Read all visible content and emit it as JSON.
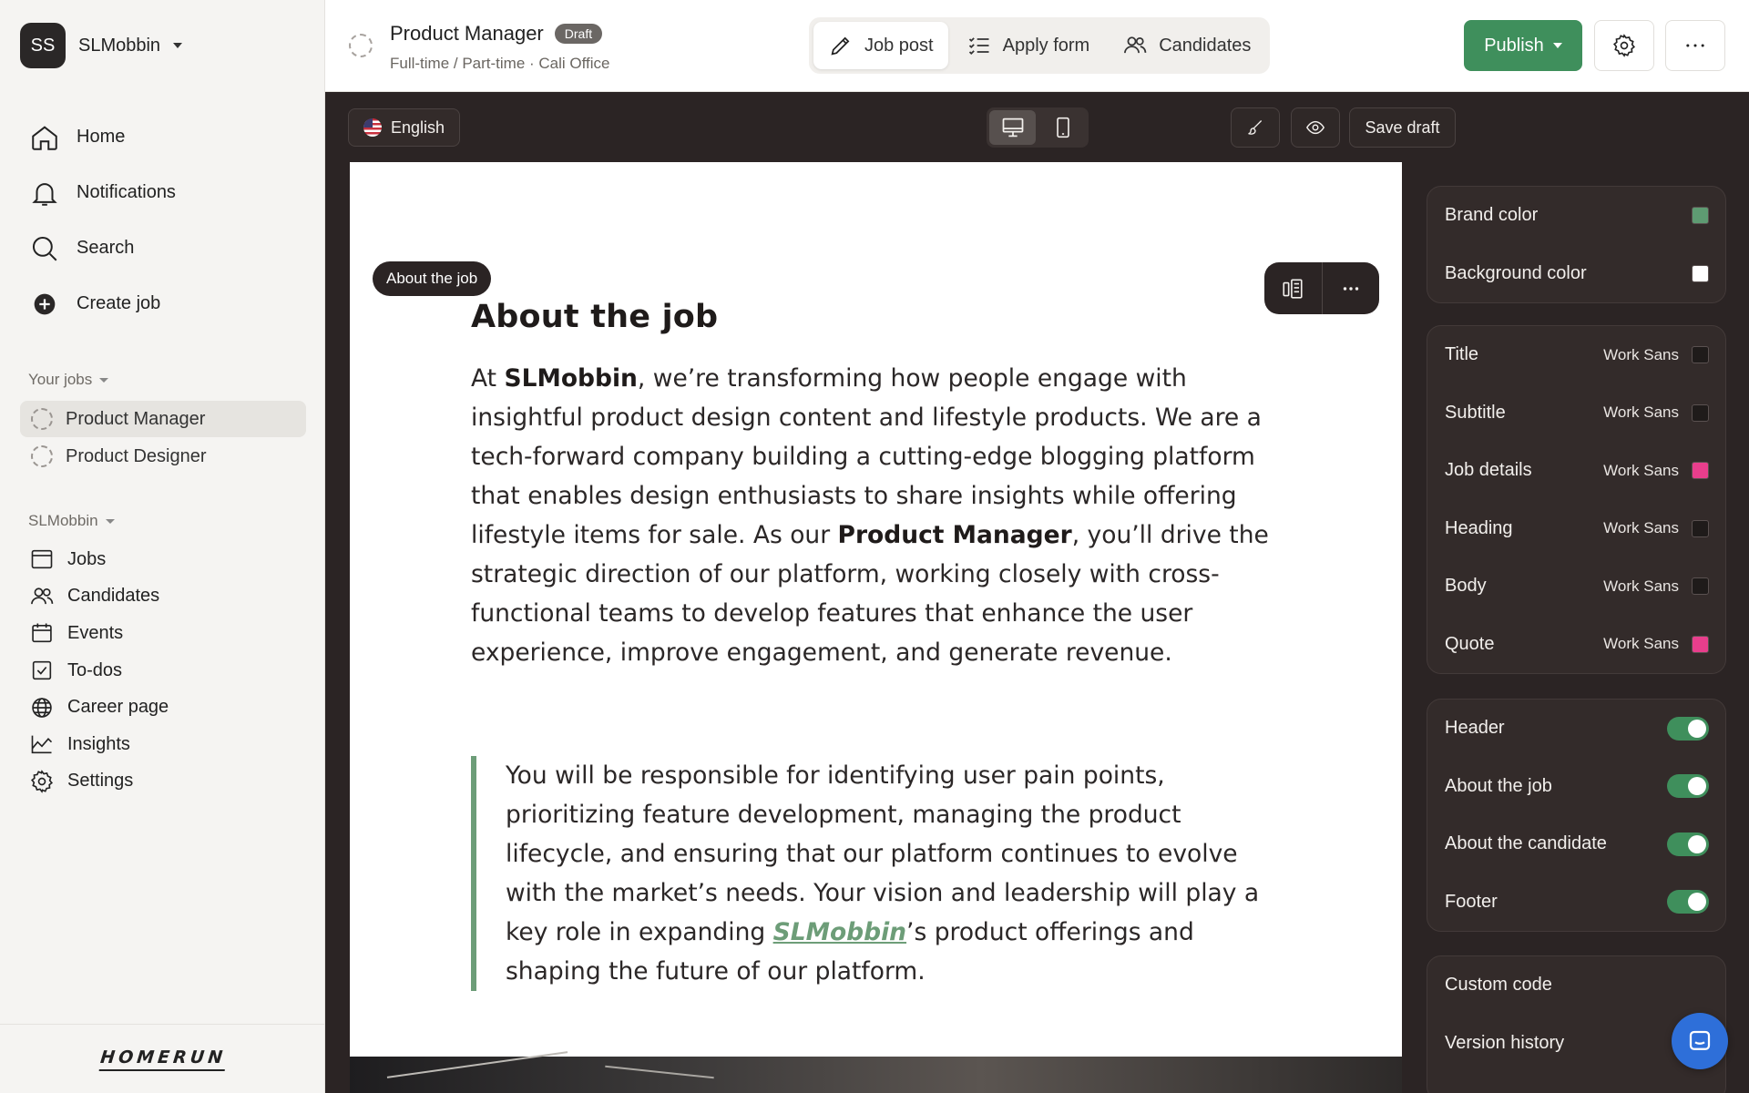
{
  "workspace": {
    "initials": "SS",
    "name": "SLMobbin"
  },
  "nav_main": [
    {
      "label": "Home",
      "icon": "home-icon"
    },
    {
      "label": "Notifications",
      "icon": "bell-icon"
    },
    {
      "label": "Search",
      "icon": "search-icon"
    },
    {
      "label": "Create job",
      "icon": "plus-circle-icon"
    }
  ],
  "your_jobs": {
    "label": "Your jobs",
    "items": [
      {
        "label": "Product Manager",
        "active": true
      },
      {
        "label": "Product Designer",
        "active": false
      }
    ]
  },
  "org_section": {
    "label": "SLMobbin",
    "items": [
      {
        "label": "Jobs",
        "icon": "browser-icon"
      },
      {
        "label": "Candidates",
        "icon": "users-icon"
      },
      {
        "label": "Events",
        "icon": "calendar-icon"
      },
      {
        "label": "To-dos",
        "icon": "checkbox-icon"
      },
      {
        "label": "Career page",
        "icon": "globe-icon"
      },
      {
        "label": "Insights",
        "icon": "chart-icon"
      },
      {
        "label": "Settings",
        "icon": "gear-icon"
      }
    ]
  },
  "logo_text": "HOMERUN",
  "header": {
    "job_title": "Product Manager",
    "badge": "Draft",
    "subtitle": "Full-time / Part-time · Cali Office",
    "tabs": [
      {
        "label": "Job post",
        "active": true
      },
      {
        "label": "Apply form",
        "active": false
      },
      {
        "label": "Candidates",
        "active": false
      }
    ],
    "publish_label": "Publish"
  },
  "editor_toolbar": {
    "language": "English",
    "save_label": "Save draft"
  },
  "canvas": {
    "section_tag": "About the job",
    "heading": "About the job",
    "body": {
      "p1": "At ",
      "company": "SLMobbin",
      "p2": ", we’re transforming how people engage with insightful product design content and lifestyle products. We are a tech-forward company building a cutting-edge blogging platform that enables design enthusiasts to share insights while offering lifestyle items for sale. As our ",
      "role": "Product Manager",
      "p3": ", you’ll drive the strategic direction of our platform, working closely with cross-functional teams to develop features that enhance the user experience, improve engagement, and generate revenue."
    },
    "quote": {
      "q1": "You will be responsible for identifying user pain points, prioritizing feature development, managing the product lifecycle, and ensuring that our platform continues to evolve with the market’s needs. Your vision and leadership will play a key role in expanding ",
      "brand": "SLMobbin",
      "q2": "’s product offerings and shaping the future of our platform."
    }
  },
  "panel": {
    "colors": [
      {
        "label": "Brand color",
        "color": "#5e9b72"
      },
      {
        "label": "Background color",
        "color": "#ffffff"
      }
    ],
    "typography": [
      {
        "label": "Title",
        "font": "Work Sans",
        "color": "#1f1b1a"
      },
      {
        "label": "Subtitle",
        "font": "Work Sans",
        "color": "#1f1b1a"
      },
      {
        "label": "Job details",
        "font": "Work Sans",
        "color": "#e83e8c"
      },
      {
        "label": "Heading",
        "font": "Work Sans",
        "color": "#1f1b1a"
      },
      {
        "label": "Body",
        "font": "Work Sans",
        "color": "#1f1b1a"
      },
      {
        "label": "Quote",
        "font": "Work Sans",
        "color": "#e83e8c"
      }
    ],
    "sections": [
      {
        "label": "Header",
        "on": true
      },
      {
        "label": "About the job",
        "on": true
      },
      {
        "label": "About the candidate",
        "on": true
      },
      {
        "label": "Footer",
        "on": true
      }
    ],
    "misc": [
      {
        "label": "Custom code"
      },
      {
        "label": "Version history"
      }
    ]
  },
  "colors": {
    "accent_green": "#3f8f5c",
    "quote_bar": "#6d9d78",
    "dark_bg": "#2b2424"
  }
}
